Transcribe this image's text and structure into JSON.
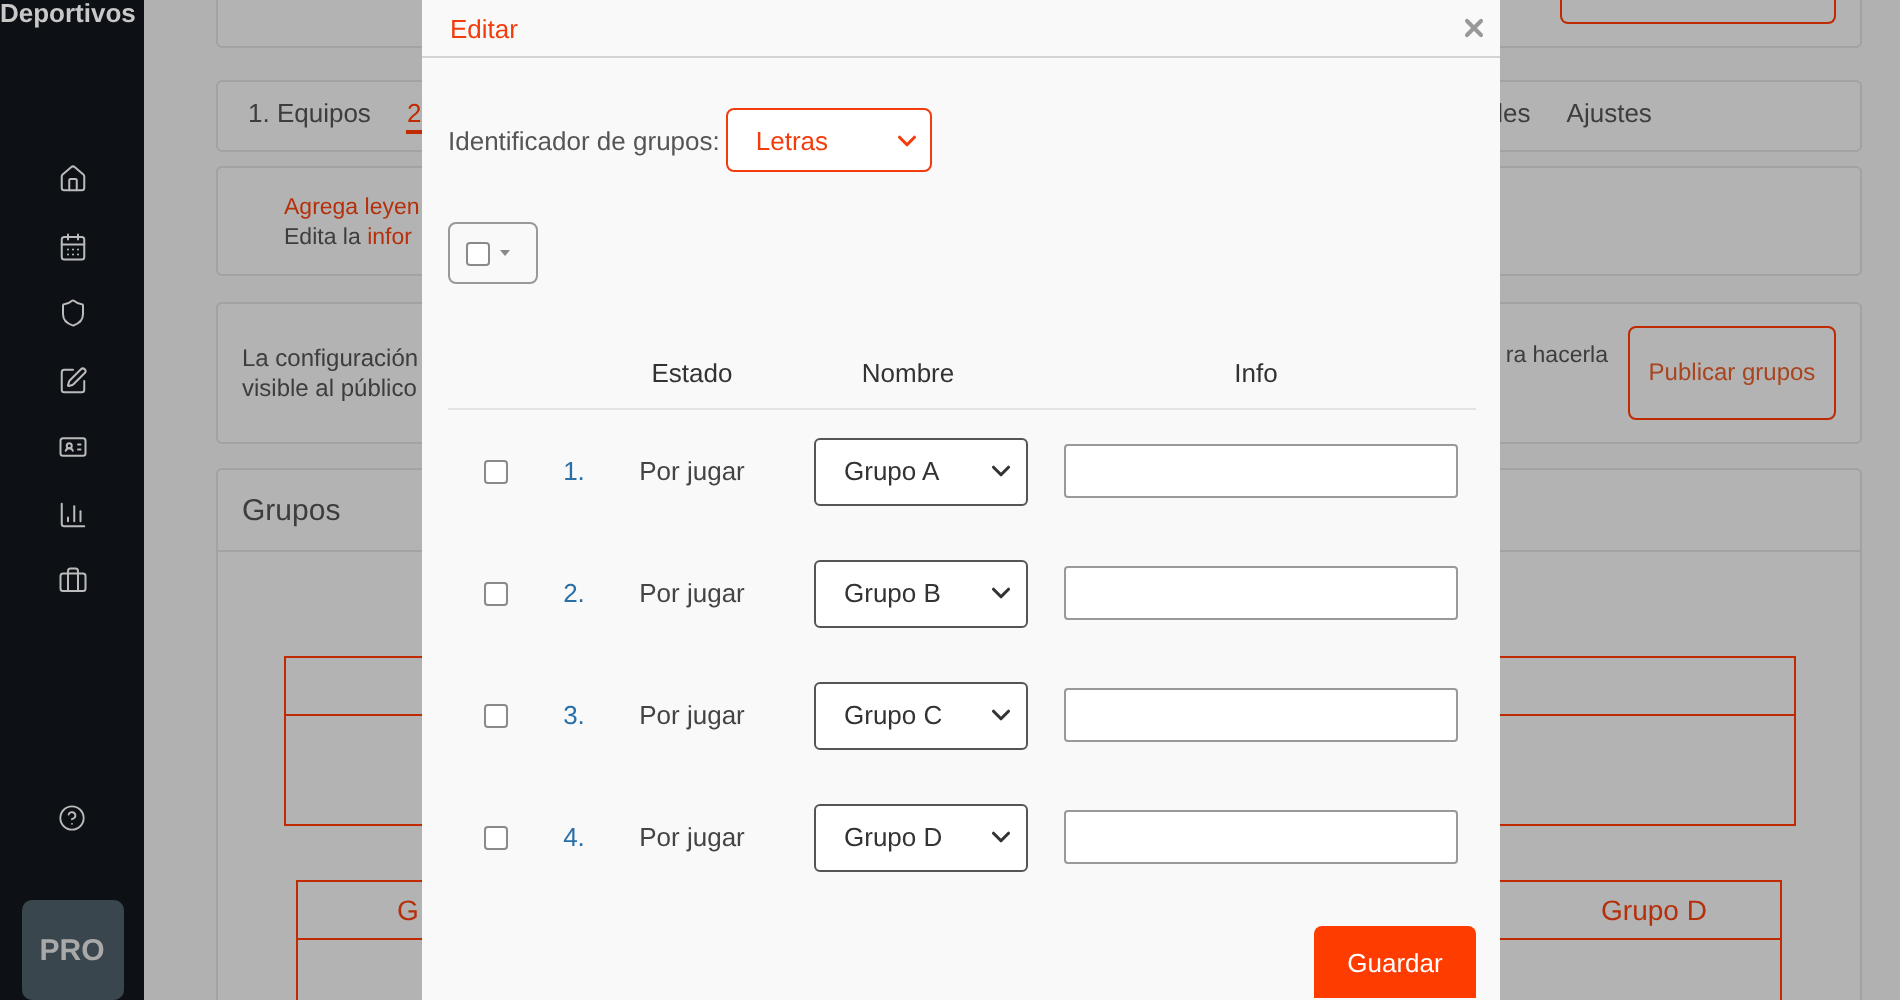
{
  "sidebar": {
    "brand": "Deportivos",
    "badge": "PRO"
  },
  "background": {
    "tabs": [
      {
        "label": "1. Equipos",
        "selected": false
      },
      {
        "label": "2",
        "selected": true
      },
      {
        "label": "les",
        "selected": false
      },
      {
        "label": "Ajustes",
        "selected": false
      }
    ],
    "notice": {
      "line_1": "Agrega leyen",
      "line_2": "Edita la",
      "line_2_link": "infor"
    },
    "publish": {
      "text_left": [
        "La configuración",
        "visible al público"
      ],
      "text_right": "ra hacerla",
      "button": "Publicar grupos"
    },
    "groups": {
      "title": "Grupos",
      "bracket_headers": [
        "G",
        "Grupo D"
      ]
    }
  },
  "modal": {
    "title": "Editar",
    "identifier_label": "Identificador de grupos:",
    "identifier_value": "Letras",
    "columns": [
      "Estado",
      "Nombre",
      "Info"
    ],
    "rows": [
      {
        "number": "1.",
        "status": "Por jugar",
        "name": "Grupo A",
        "checked": false
      },
      {
        "number": "2.",
        "status": "Por jugar",
        "name": "Grupo B",
        "checked": false
      },
      {
        "number": "3.",
        "status": "Por jugar",
        "name": "Grupo C",
        "checked": false
      },
      {
        "number": "4.",
        "status": "Por jugar",
        "name": "Grupo D",
        "checked": false
      }
    ],
    "save": "Guardar"
  }
}
